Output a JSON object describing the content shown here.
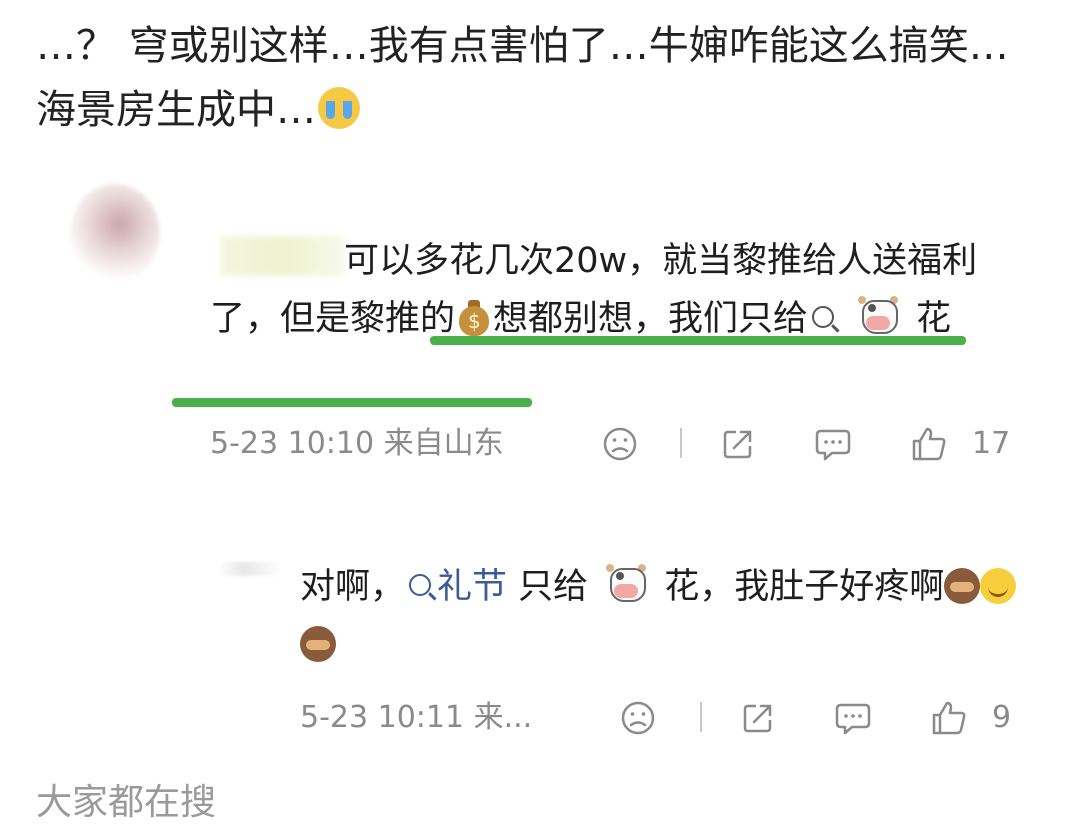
{
  "post": {
    "text": "…？ 穹或别这样…我有点害怕了…牛婶咋能这么搞笑…海景房生成中…",
    "trailing_emoji": "loudly-crying-face-icon"
  },
  "screenshot": {
    "comment": {
      "text_a": "可以多花几次20w，就当黎推给人送福利了，但是黎推的",
      "emoji_money": "money-bag-icon",
      "text_b": "想都别想，我们只给",
      "emoji_cow": "cow-face-icon",
      "text_c": "花",
      "highlight_color": "#4ab04a",
      "time": "5-23 10:10 来自山东",
      "like_count": "17"
    },
    "reply": {
      "text_a": "对啊，",
      "search_term": "礼节",
      "text_b": "只给",
      "emoji_cow": "cow-face-icon",
      "text_c": "花，我肚子好疼啊",
      "emojis": [
        "see-no-evil-monkey-icon",
        "smiling-face-icon",
        "see-no-evil-monkey-icon"
      ],
      "time": "5-23 10:11 来...",
      "like_count": "9",
      "link_color": "#3a5a9a"
    }
  },
  "footer": {
    "label": "大家都在搜"
  }
}
